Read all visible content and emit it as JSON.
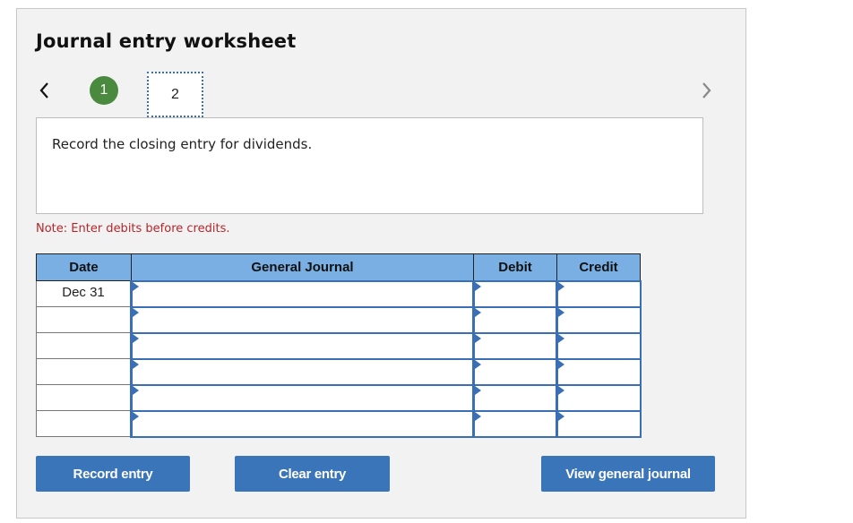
{
  "worksheet": {
    "title": "Journal entry worksheet",
    "steps": [
      {
        "label": "1",
        "status": "completed"
      },
      {
        "label": "2",
        "status": "current"
      }
    ],
    "nav": {
      "prev_icon": "chevron-left-icon",
      "next_icon": "chevron-right-icon"
    },
    "instruction": "Record the closing entry for dividends.",
    "note": "Note: Enter debits before credits.",
    "colors": {
      "accent": "#3a75b9",
      "header": "#7aafe3",
      "step_done": "#4a8a3f",
      "note": "#b5262b"
    }
  },
  "journal": {
    "headers": {
      "date": "Date",
      "general_journal": "General Journal",
      "debit": "Debit",
      "credit": "Credit"
    },
    "rows": [
      {
        "date": "Dec 31",
        "account": "",
        "debit": "",
        "credit": ""
      },
      {
        "date": "",
        "account": "",
        "debit": "",
        "credit": ""
      },
      {
        "date": "",
        "account": "",
        "debit": "",
        "credit": ""
      },
      {
        "date": "",
        "account": "",
        "debit": "",
        "credit": ""
      },
      {
        "date": "",
        "account": "",
        "debit": "",
        "credit": ""
      },
      {
        "date": "",
        "account": "",
        "debit": "",
        "credit": ""
      }
    ]
  },
  "buttons": {
    "record": "Record entry",
    "clear": "Clear entry",
    "view": "View general journal"
  }
}
